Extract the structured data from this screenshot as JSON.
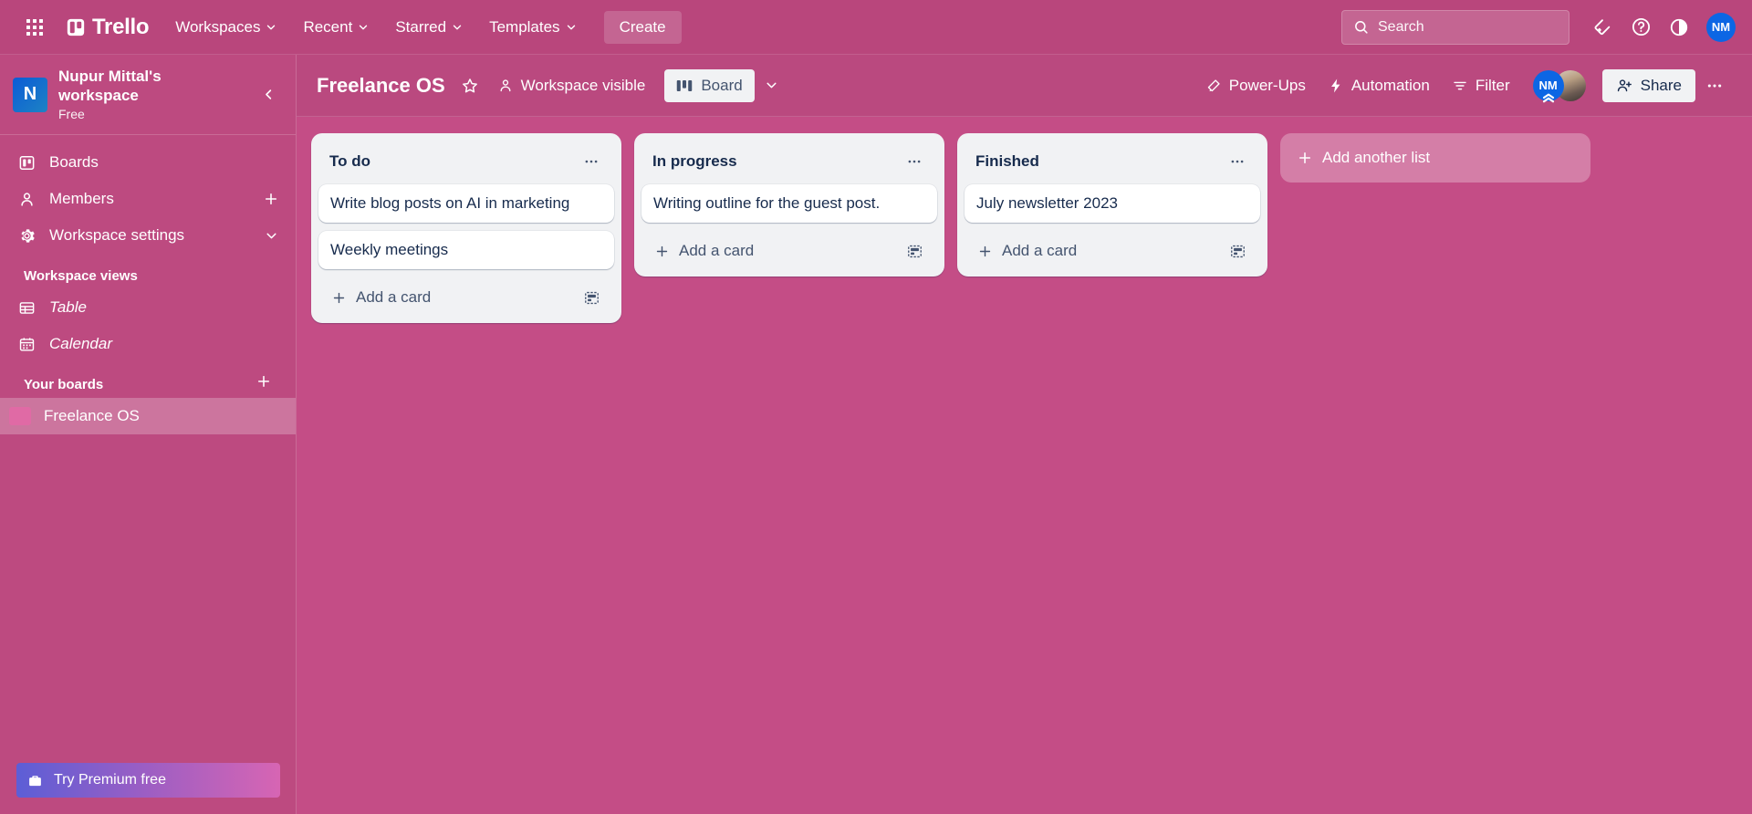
{
  "app": {
    "brand": "Trello",
    "accent_nav": "#b9467c",
    "board_bg": "#c44d86",
    "sidebar_bg": "#bd4a80",
    "list_bg": "#f1f2f4"
  },
  "topnav": {
    "apps_label": "apps-grid",
    "items": [
      {
        "label": "Workspaces",
        "has_chevron": true
      },
      {
        "label": "Recent",
        "has_chevron": true
      },
      {
        "label": "Starred",
        "has_chevron": true
      },
      {
        "label": "Templates",
        "has_chevron": true
      }
    ],
    "create_label": "Create",
    "search_placeholder": "Search",
    "icons": [
      "notification-bell-icon",
      "help-icon",
      "theme-toggle-icon"
    ],
    "avatar_initials": "NM"
  },
  "sidebar": {
    "workspace_name": "Nupur Mittal's workspace",
    "workspace_plan": "Free",
    "workspace_initial": "N",
    "collapse_label": "collapse-sidebar",
    "nav": [
      {
        "label": "Boards",
        "icon": "boards-icon",
        "trailing": "none"
      },
      {
        "label": "Members",
        "icon": "members-icon",
        "trailing": "plus"
      },
      {
        "label": "Workspace settings",
        "icon": "gear-icon",
        "trailing": "chevron-down"
      }
    ],
    "views_heading": "Workspace views",
    "views": [
      {
        "label": "Table",
        "icon": "table-icon"
      },
      {
        "label": "Calendar",
        "icon": "calendar-icon"
      }
    ],
    "boards_heading": "Your boards",
    "boards_add_label": "add-board",
    "boards": [
      {
        "label": "Freelance OS",
        "color": "#e06aa5",
        "active": true
      }
    ],
    "premium_label": "Try Premium free",
    "premium_icon": "briefcase-icon"
  },
  "boardbar": {
    "title": "Freelance OS",
    "star_label": "star-board",
    "visibility_label": "Workspace visible",
    "view_label": "Board",
    "view_chevron": "chevron-down",
    "actions": [
      {
        "label": "Power-Ups",
        "icon": "rocket-icon"
      },
      {
        "label": "Automation",
        "icon": "lightning-icon"
      },
      {
        "label": "Filter",
        "icon": "filter-icon"
      }
    ],
    "members": [
      {
        "initials": "NM",
        "type": "initials"
      },
      {
        "initials": "",
        "type": "photo"
      }
    ],
    "share_label": "Share",
    "more_label": "board-menu"
  },
  "board": {
    "lists": [
      {
        "title": "To do",
        "cards": [
          {
            "text": "Write blog posts on AI in marketing"
          },
          {
            "text": "Weekly meetings"
          }
        ],
        "add_card_label": "Add a card"
      },
      {
        "title": "In progress",
        "cards": [
          {
            "text": "Writing outline for the guest post."
          }
        ],
        "add_card_label": "Add a card"
      },
      {
        "title": "Finished",
        "cards": [
          {
            "text": "July newsletter 2023"
          }
        ],
        "add_card_label": "Add a card"
      }
    ],
    "add_list_label": "Add another list"
  }
}
